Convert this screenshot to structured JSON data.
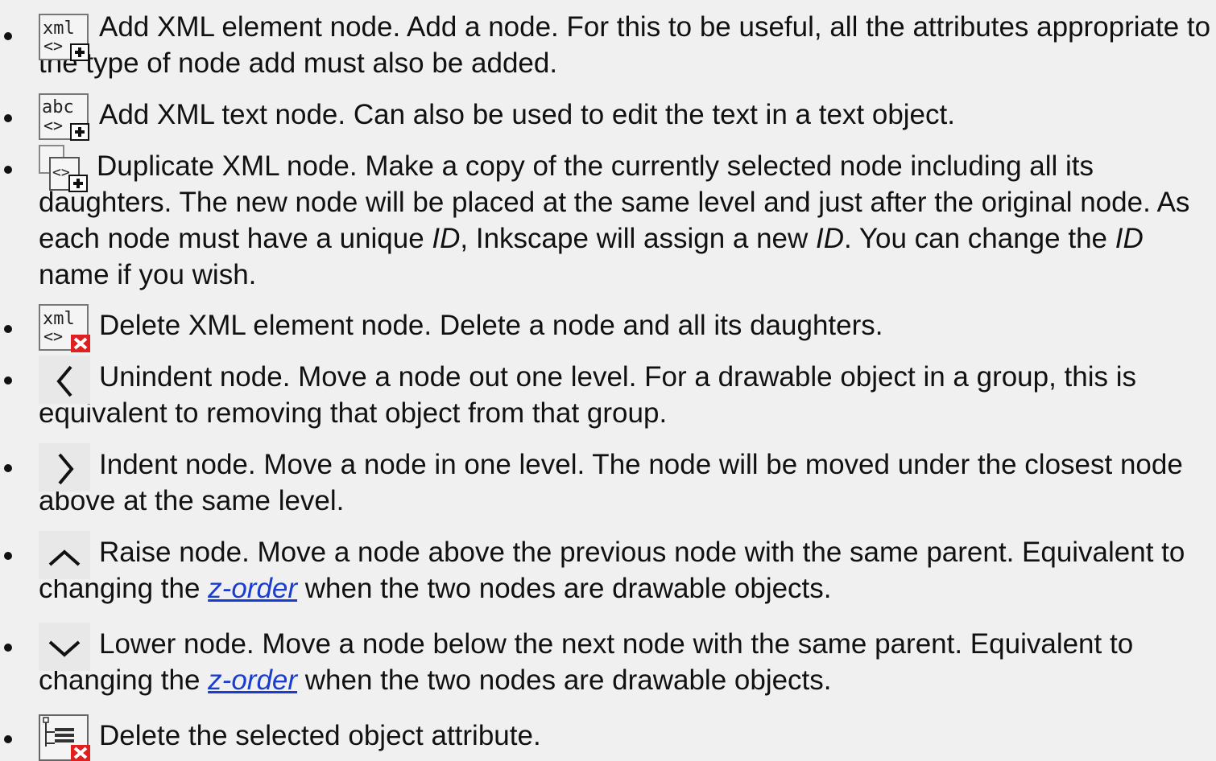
{
  "items": [
    {
      "icon": "xml-add-element-icon",
      "text": "Add XML element node. Add a node. For this to be useful, all the attributes appropriate to the type of node add must also be added."
    },
    {
      "icon": "xml-add-text-icon",
      "text": "Add XML text node. Can also be used to edit the text in a text object."
    },
    {
      "icon": "xml-duplicate-node-icon",
      "text_a": "Duplicate XML node. Make a copy of the currently selected node including all its daughters. The new node will be placed at the same level and just after the original node. As each node must have a unique ",
      "em1": "ID",
      "text_b": ", Inkscape will assign a new ",
      "em2": "ID",
      "text_c": ". You can change the ",
      "em3": "ID",
      "text_d": " name if you wish."
    },
    {
      "icon": "xml-delete-element-icon",
      "text": "Delete XML element node. Delete a node and all its daughters."
    },
    {
      "icon": "unindent-node-icon",
      "text": "Unindent node. Move a node out one level. For a drawable object in a group, this is equivalent to removing that object from that group."
    },
    {
      "icon": "indent-node-icon",
      "text": "Indent node. Move a node in one level. The node will be moved under the closest node above at the same level."
    },
    {
      "icon": "raise-node-icon",
      "text_a": "Raise node. Move a node above the previous node with the same parent. Equivalent to changing the ",
      "link": "z-order",
      "text_b": " when the two nodes are drawable objects."
    },
    {
      "icon": "lower-node-icon",
      "text_a": "Lower node. Move a node below the next node with the same parent. Equivalent to changing the ",
      "link": "z-order",
      "text_b": " when the two nodes are drawable objects."
    },
    {
      "icon": "delete-attribute-icon",
      "text": "Delete the selected object attribute."
    }
  ],
  "icon_labels": {
    "xml": "xml",
    "abc": "abc",
    "brackets": "<>"
  },
  "colors": {
    "link": "#1a3ccf",
    "delete_red": "#e02020",
    "background": "#f0f0f0"
  }
}
